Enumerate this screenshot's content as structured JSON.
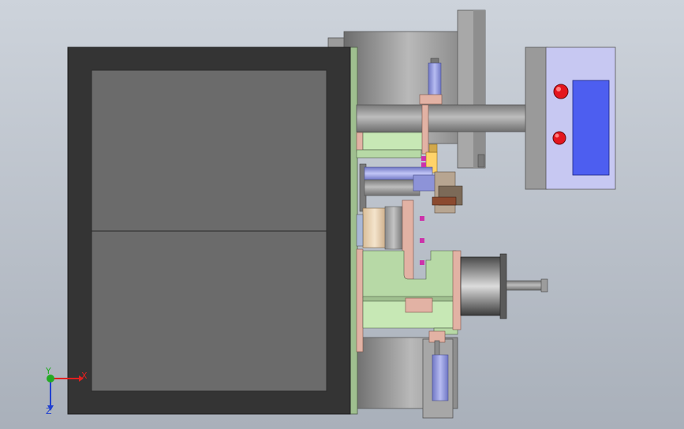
{
  "viewport": {
    "background_top": "#cdd3db",
    "background_bottom": "#a9b0ba"
  },
  "colors": {
    "frame": "#343434",
    "panel": "#6b6b6b",
    "panel_edge": "#2a2a2a",
    "plate_green": "#b7d9a6",
    "plate_light_green": "#c7e8b5",
    "cylinder_grey": "#9a9a9a",
    "bracket_pink": "#e2b2a4",
    "cylinder_blue": "#8d93d8",
    "control_box": "#c7c8f2",
    "screen_blue": "#4d5ef0",
    "button_red": "#e4151e",
    "tan_roller": "#e8d2b4",
    "yellow_block": "#ffd36a",
    "motor_dark": "#2f2f2f"
  },
  "triad": {
    "x_label": "X",
    "y_label": "Y",
    "z_label": "Z",
    "x_color": "#e02020",
    "y_color": "#22aa22",
    "z_color": "#2040d0"
  },
  "control_box": {
    "buttons": [
      "red-button",
      "red-button"
    ],
    "screen": "display-screen"
  }
}
